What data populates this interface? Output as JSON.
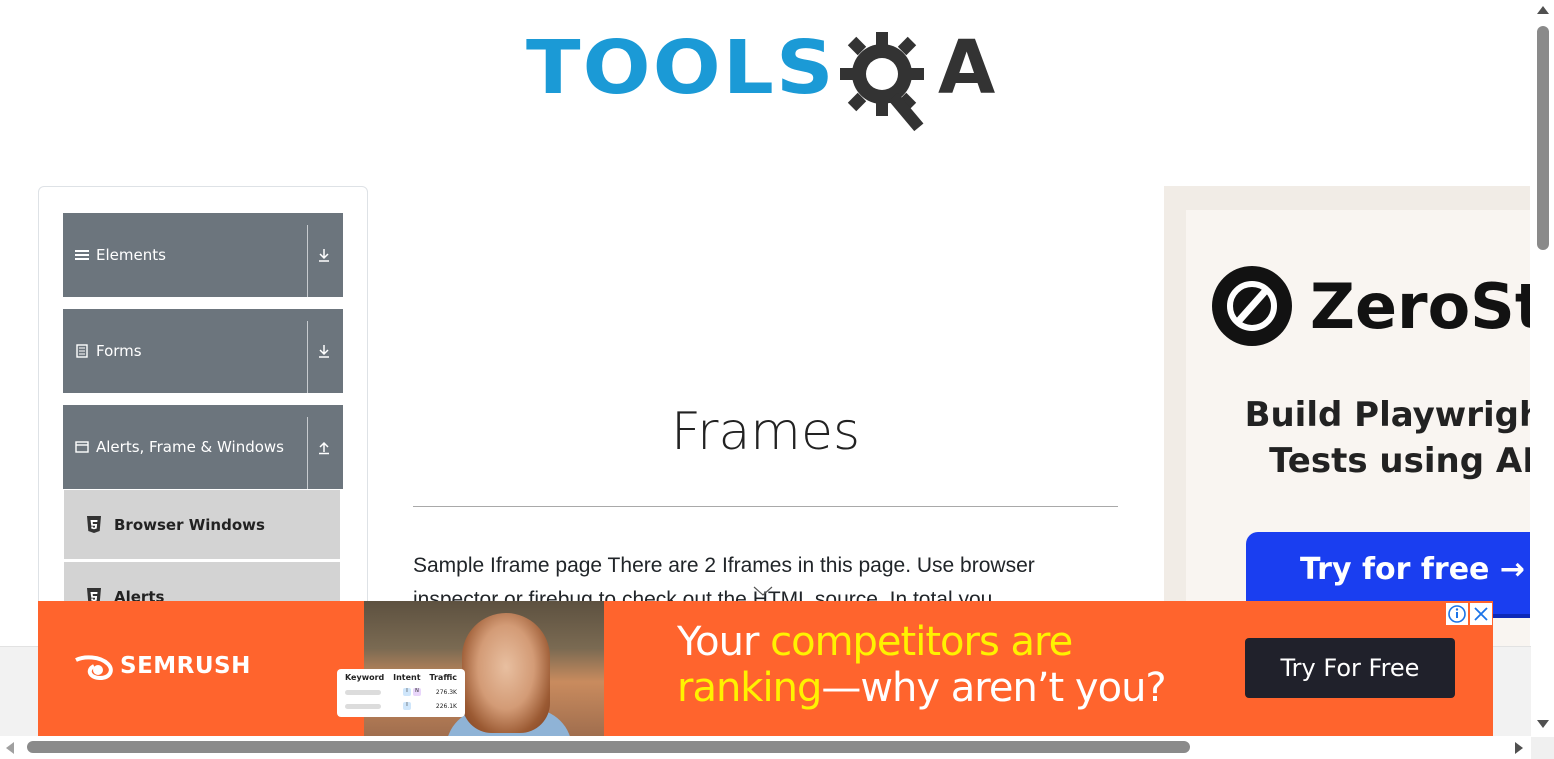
{
  "header": {
    "logo_text_tools": "TOOLS",
    "logo_text_a": "A",
    "logo_colors": {
      "tools": "#1b9ad6",
      "qa": "#333333"
    }
  },
  "sidebar": {
    "groups": [
      {
        "label": "Elements",
        "icon": "hamburger-icon",
        "arrow": "download-arrow-icon"
      },
      {
        "label": "Forms",
        "icon": "document-icon",
        "arrow": "download-arrow-icon"
      },
      {
        "label": "Alerts, Frame & Windows",
        "icon": "window-icon",
        "arrow": "upload-arrow-icon"
      }
    ],
    "items": [
      {
        "label": "Browser Windows",
        "icon": "html5-icon"
      },
      {
        "label": "Alerts",
        "icon": "html5-icon"
      }
    ],
    "header_color": "#6c757d",
    "item_color": "#d3d3d3"
  },
  "main": {
    "title": "Frames",
    "description": "Sample Iframe page There are 2 Iframes in this page. Use browser inspector or firebug to check out the HTML source. In total you"
  },
  "right_ad": {
    "brand": "ZeroStep",
    "headline": "Build Playwright\nTests using AI",
    "cta": "Try for free →",
    "cta_color": "#1a3ef0"
  },
  "bottom_ad": {
    "brand": "SEMRUSH",
    "headline_part1": "Your ",
    "headline_highlight1": "competitors are",
    "headline_highlight2": "ranking",
    "headline_part2": "—why aren’t you?",
    "cta": "Try For Free",
    "card": {
      "col1": "Keyword",
      "col2": "Intent",
      "col3": "Traffic",
      "row1_badge1": "I",
      "row1_badge2": "N",
      "row1_value": "276.3K",
      "row2_badge1": "I",
      "row2_value": "226.1K"
    },
    "background": "#ff642d",
    "highlight_color": "#fff200"
  }
}
